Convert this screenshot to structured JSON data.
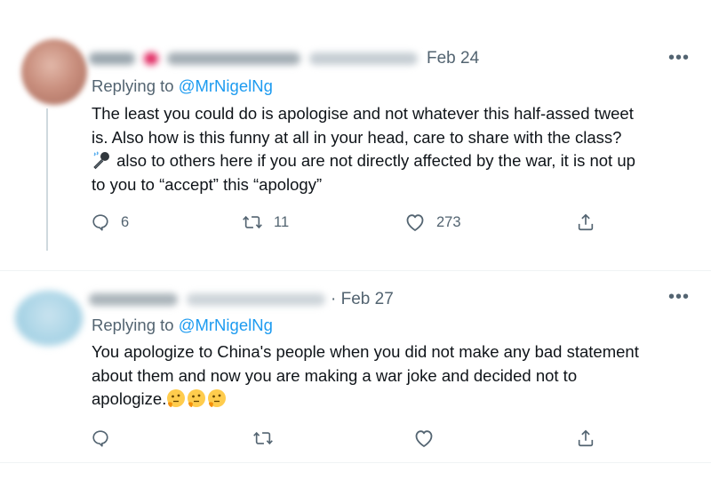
{
  "tweets": [
    {
      "date": "Feb 24",
      "more_label": "•••",
      "replying_prefix": "Replying to ",
      "replying_handle": "@MrNigelNg",
      "lines": [
        "The least you could do is apologise and not whatever this half-assed tweet",
        "is. Also how is this funny at all in your head, care to share with the class?",
        " also to others here if you are not directly affected by the war, it is not up",
        "to you to “accept” this “apology”"
      ],
      "leading_emoji": "microphone-icon",
      "actions": {
        "reply_count": "6",
        "retweet_count": "11",
        "like_count": "273"
      },
      "colors": {
        "avatar": "#c98f7e",
        "name_blur_red": "#e0245e"
      }
    },
    {
      "date": "· Feb 27",
      "more_label": "•••",
      "replying_prefix": "Replying to ",
      "replying_handle": "@MrNigelNg",
      "lines": [
        "You apologize to China's people when you did not make any bad statement",
        "about them and now you are making a war joke and decided not to",
        "apologize."
      ],
      "trailing_emojis": [
        "thinking-face-icon",
        "thinking-face-icon",
        "thinking-face-icon"
      ],
      "actions": {
        "reply_count": "",
        "retweet_count": "",
        "like_count": ""
      },
      "colors": {
        "avatar": "#a9d4e6"
      }
    }
  ],
  "colors": {
    "mention": "#1d9bf0",
    "secondary_text": "#536471",
    "primary_text": "#0f1419",
    "divider": "#eff3f4"
  }
}
